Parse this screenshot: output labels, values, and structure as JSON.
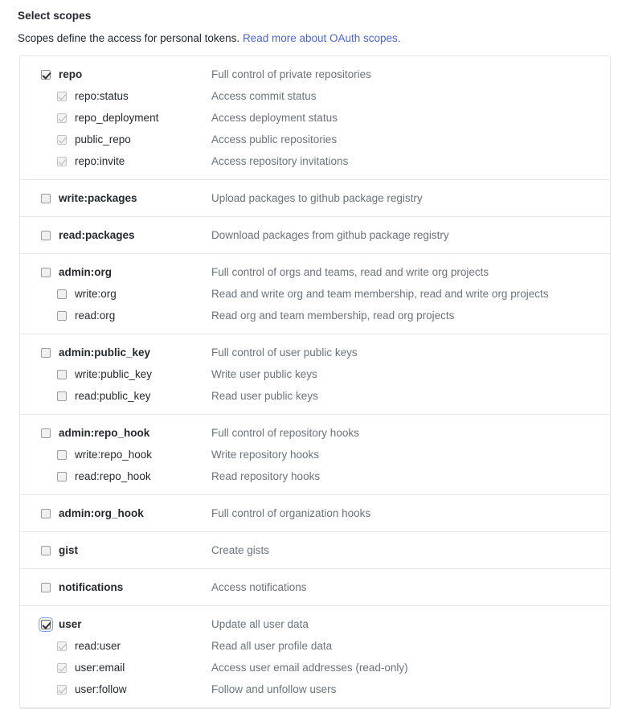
{
  "header": {
    "title": "Select scopes",
    "description_prefix": "Scopes define the access for personal tokens.",
    "link_text": "Read more about OAuth scopes.",
    "link_color": "#4a66d6"
  },
  "colors": {
    "text": "#24292e",
    "description": "#6a737d",
    "border": "#e3e5e8",
    "focus_ring": "#7b9fe0"
  },
  "groups": [
    {
      "parent": {
        "name": "repo",
        "description": "Full control of private repositories",
        "checked": true,
        "disabled": false,
        "focused": false
      },
      "children": [
        {
          "name": "repo:status",
          "description": "Access commit status",
          "checked": true,
          "disabled": true
        },
        {
          "name": "repo_deployment",
          "description": "Access deployment status",
          "checked": true,
          "disabled": true
        },
        {
          "name": "public_repo",
          "description": "Access public repositories",
          "checked": true,
          "disabled": true
        },
        {
          "name": "repo:invite",
          "description": "Access repository invitations",
          "checked": true,
          "disabled": true
        }
      ]
    },
    {
      "parent": {
        "name": "write:packages",
        "description": "Upload packages to github package registry",
        "checked": false,
        "disabled": false,
        "focused": false
      },
      "children": []
    },
    {
      "parent": {
        "name": "read:packages",
        "description": "Download packages from github package registry",
        "checked": false,
        "disabled": false,
        "focused": false
      },
      "children": []
    },
    {
      "parent": {
        "name": "admin:org",
        "description": "Full control of orgs and teams, read and write org projects",
        "checked": false,
        "disabled": false,
        "focused": false
      },
      "children": [
        {
          "name": "write:org",
          "description": "Read and write org and team membership, read and write org projects",
          "checked": false,
          "disabled": false
        },
        {
          "name": "read:org",
          "description": "Read org and team membership, read org projects",
          "checked": false,
          "disabled": false
        }
      ]
    },
    {
      "parent": {
        "name": "admin:public_key",
        "description": "Full control of user public keys",
        "checked": false,
        "disabled": false,
        "focused": false
      },
      "children": [
        {
          "name": "write:public_key",
          "description": "Write user public keys",
          "checked": false,
          "disabled": false
        },
        {
          "name": "read:public_key",
          "description": "Read user public keys",
          "checked": false,
          "disabled": false
        }
      ]
    },
    {
      "parent": {
        "name": "admin:repo_hook",
        "description": "Full control of repository hooks",
        "checked": false,
        "disabled": false,
        "focused": false
      },
      "children": [
        {
          "name": "write:repo_hook",
          "description": "Write repository hooks",
          "checked": false,
          "disabled": false
        },
        {
          "name": "read:repo_hook",
          "description": "Read repository hooks",
          "checked": false,
          "disabled": false
        }
      ]
    },
    {
      "parent": {
        "name": "admin:org_hook",
        "description": "Full control of organization hooks",
        "checked": false,
        "disabled": false,
        "focused": false
      },
      "children": []
    },
    {
      "parent": {
        "name": "gist",
        "description": "Create gists",
        "checked": false,
        "disabled": false,
        "focused": false
      },
      "children": []
    },
    {
      "parent": {
        "name": "notifications",
        "description": "Access notifications",
        "checked": false,
        "disabled": false,
        "focused": false
      },
      "children": []
    },
    {
      "parent": {
        "name": "user",
        "description": "Update all user data",
        "checked": true,
        "disabled": false,
        "focused": true
      },
      "children": [
        {
          "name": "read:user",
          "description": "Read all user profile data",
          "checked": true,
          "disabled": true
        },
        {
          "name": "user:email",
          "description": "Access user email addresses (read-only)",
          "checked": true,
          "disabled": true
        },
        {
          "name": "user:follow",
          "description": "Follow and unfollow users",
          "checked": true,
          "disabled": true
        }
      ]
    }
  ]
}
